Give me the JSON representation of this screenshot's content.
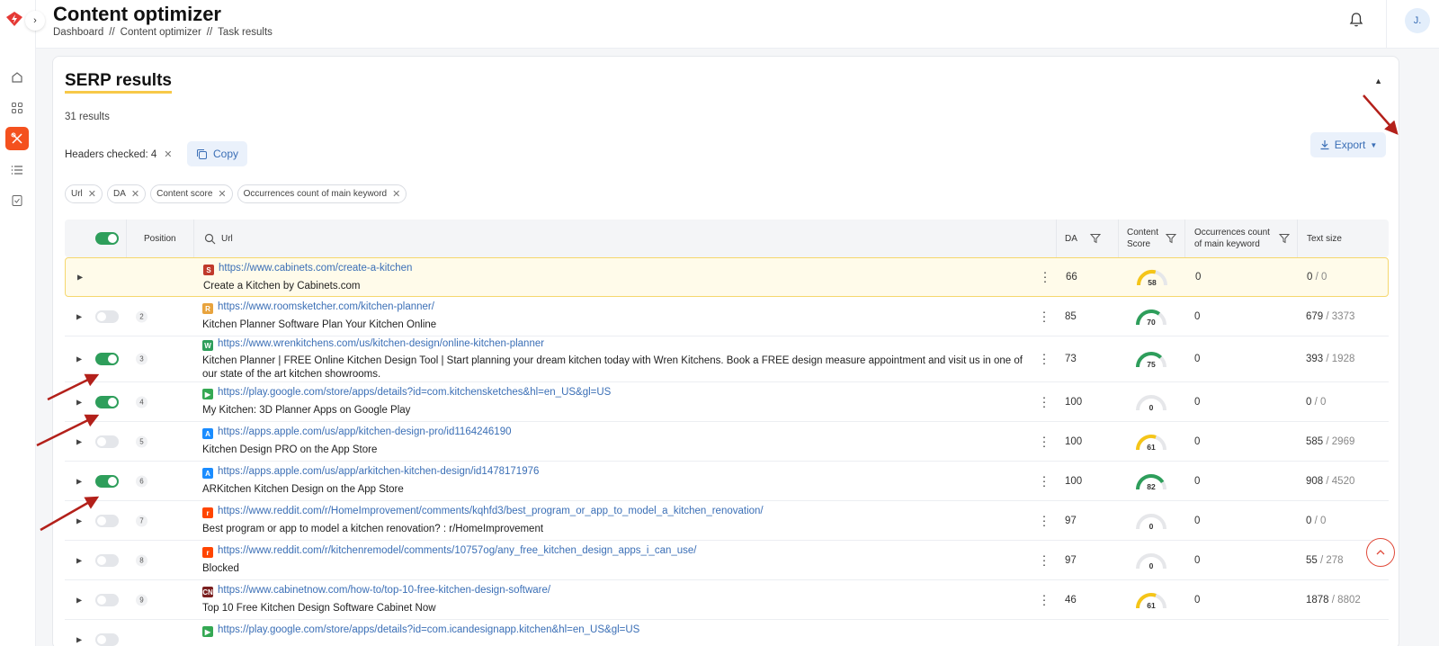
{
  "header": {
    "title": "Content optimizer",
    "breadcrumb": [
      "Dashboard",
      "//",
      "Content optimizer",
      "//",
      "Task results"
    ],
    "avatar_initial": "J."
  },
  "sidebar": {
    "items": [
      {
        "icon": "home-icon"
      },
      {
        "icon": "apps-grid-icon"
      },
      {
        "icon": "tools-icon",
        "active": true
      },
      {
        "icon": "list-icon"
      },
      {
        "icon": "document-check-icon"
      }
    ]
  },
  "serp": {
    "title": "SERP results",
    "results_count": "31 results",
    "headers_checked": "Headers checked: 4",
    "copy_label": "Copy",
    "export_label": "Export",
    "chips": [
      "Url",
      "DA",
      "Content score",
      "Occurrences count of main keyword"
    ]
  },
  "table": {
    "columns": {
      "position": "Position",
      "url": "Url",
      "da": "DA",
      "content_score_1": "Content",
      "content_score_2": "Score",
      "occurrences_1": "Occurrences count",
      "occurrences_2": "of main keyword",
      "text_size": "Text size"
    },
    "rows": [
      {
        "position": "",
        "url": "https://www.cabinets.com/create-a-kitchen",
        "title": "Create a Kitchen by Cabinets.com",
        "da": "66",
        "score": "58",
        "score_pct": 0.58,
        "score_color": "#f5c518",
        "occ": "0",
        "size": "0",
        "total": "/ 0",
        "enabled": null,
        "favicon_color": "#c0392b",
        "favicon_letter": "S"
      },
      {
        "position": "2",
        "url": "https://www.roomsketcher.com/kitchen-planner/",
        "title": "Kitchen Planner Software Plan Your Kitchen Online",
        "da": "85",
        "score": "70",
        "score_pct": 0.7,
        "score_color": "#2e9e5b",
        "occ": "0",
        "size": "679",
        "total": "/ 3373",
        "enabled": false,
        "favicon_color": "#e8a33d",
        "favicon_letter": "R"
      },
      {
        "position": "3",
        "url": "https://www.wrenkitchens.com/us/kitchen-design/online-kitchen-planner",
        "title": "Kitchen Planner | FREE Online Kitchen Design Tool | Start planning your dream kitchen today with Wren Kitchens. Book a FREE design measure appointment and visit us in one of our state of the art kitchen showrooms.",
        "da": "73",
        "score": "75",
        "score_pct": 0.75,
        "score_color": "#2e9e5b",
        "occ": "0",
        "size": "393",
        "total": "/ 1928",
        "enabled": true,
        "favicon_color": "#2e9e5b",
        "favicon_letter": "W"
      },
      {
        "position": "4",
        "url": "https://play.google.com/store/apps/details?id=com.kitchensketches&hl=en_US&gl=US",
        "title": "My Kitchen: 3D Planner Apps on Google Play",
        "da": "100",
        "score": "0",
        "score_pct": 0,
        "score_color": "#cccccc",
        "occ": "0",
        "size": "0",
        "total": "/ 0",
        "enabled": true,
        "favicon_color": "#34a853",
        "favicon_letter": "▶"
      },
      {
        "position": "5",
        "url": "https://apps.apple.com/us/app/kitchen-design-pro/id1164246190",
        "title": "Kitchen Design PRO on the App Store",
        "da": "100",
        "score": "61",
        "score_pct": 0.61,
        "score_color": "#f5c518",
        "occ": "0",
        "size": "585",
        "total": "/ 2969",
        "enabled": false,
        "favicon_color": "#1a8cff",
        "favicon_letter": "A"
      },
      {
        "position": "6",
        "url": "https://apps.apple.com/us/app/arkitchen-kitchen-design/id1478171976",
        "title": "ARKitchen Kitchen Design on the App Store",
        "da": "100",
        "score": "82",
        "score_pct": 0.82,
        "score_color": "#2e9e5b",
        "occ": "0",
        "size": "908",
        "total": "/ 4520",
        "enabled": true,
        "favicon_color": "#1a8cff",
        "favicon_letter": "A"
      },
      {
        "position": "7",
        "url": "https://www.reddit.com/r/HomeImprovement/comments/kqhfd3/best_program_or_app_to_model_a_kitchen_renovation/",
        "title": "Best program or app to model a kitchen renovation? : r/HomeImprovement",
        "da": "97",
        "score": "0",
        "score_pct": 0,
        "score_color": "#cccccc",
        "occ": "0",
        "size": "0",
        "total": "/ 0",
        "enabled": false,
        "favicon_color": "#ff4500",
        "favicon_letter": "r"
      },
      {
        "position": "8",
        "url": "https://www.reddit.com/r/kitchenremodel/comments/10757og/any_free_kitchen_design_apps_i_can_use/",
        "title": "Blocked",
        "da": "97",
        "score": "0",
        "score_pct": 0,
        "score_color": "#cccccc",
        "occ": "0",
        "size": "55",
        "total": "/ 278",
        "enabled": false,
        "favicon_color": "#ff4500",
        "favicon_letter": "r"
      },
      {
        "position": "9",
        "url": "https://www.cabinetnow.com/how-to/top-10-free-kitchen-design-software/",
        "title": "Top 10 Free Kitchen Design Software Cabinet Now",
        "da": "46",
        "score": "61",
        "score_pct": 0.61,
        "score_color": "#f5c518",
        "occ": "0",
        "size": "1878",
        "total": "/ 8802",
        "enabled": false,
        "favicon_color": "#7a1f1f",
        "favicon_letter": "CN"
      },
      {
        "position": "",
        "url": "https://play.google.com/store/apps/details?id=com.icandesignapp.kitchen&hl=en_US&gl=US",
        "title": "",
        "da": "",
        "score": "",
        "score_pct": 0,
        "score_color": "#cccccc",
        "occ": "",
        "size": "",
        "total": "",
        "enabled": false,
        "favicon_color": "#34a853",
        "favicon_letter": "▶"
      }
    ]
  }
}
